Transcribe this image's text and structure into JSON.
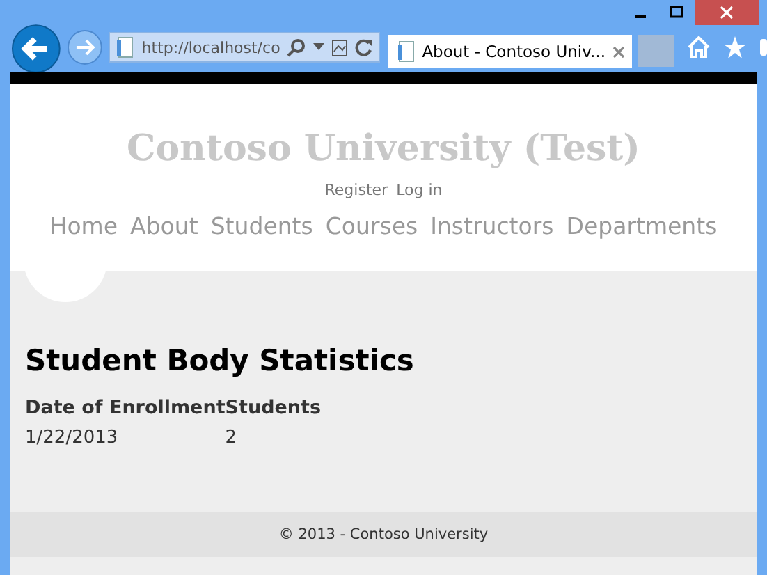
{
  "browser": {
    "address": "http://localhost/co",
    "tabs": [
      {
        "title": "About - Contoso Univ...",
        "selected": true
      }
    ]
  },
  "site": {
    "title": "Contoso University (Test)",
    "account_links": [
      "Register",
      "Log in"
    ],
    "nav": [
      "Home",
      "About",
      "Students",
      "Courses",
      "Instructors",
      "Departments"
    ]
  },
  "page": {
    "heading": "Student Body Statistics",
    "table": {
      "columns": [
        "Date of Enrollment",
        "Students"
      ],
      "rows": [
        [
          "1/22/2013",
          "2"
        ]
      ]
    }
  },
  "footer": "© 2013 - Contoso University"
}
